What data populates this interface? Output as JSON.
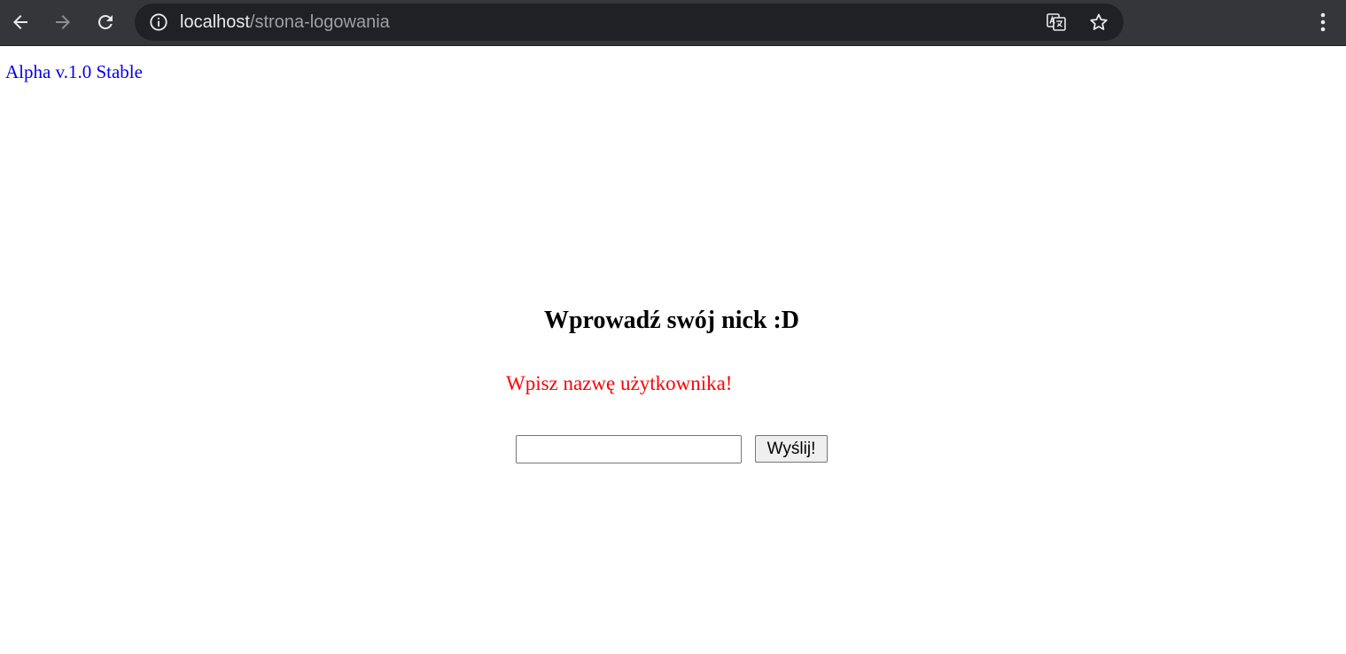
{
  "browser": {
    "url_host": "localhost",
    "url_path": "/strona-logowania",
    "icons": {
      "back": "arrow-left-icon",
      "forward": "arrow-right-icon",
      "reload": "reload-icon",
      "site_info": "info-icon",
      "translate": "translate-icon",
      "bookmark": "star-icon",
      "menu": "kebab-menu-icon"
    },
    "colors": {
      "toolbar": "#35363a",
      "omnibox": "#202124",
      "icon": "#e8eaed",
      "icon_disabled": "#8a8d91"
    }
  },
  "page": {
    "version_label": "Alpha v.1.0 Stable",
    "heading": "Wprowadź swój nick :D",
    "error_message": "Wpisz nazwę użytkownika!",
    "nick_input": {
      "value": "",
      "placeholder": ""
    },
    "submit_label": "Wyślij!",
    "colors": {
      "version": "#0000ee",
      "error": "#ff0000"
    }
  }
}
